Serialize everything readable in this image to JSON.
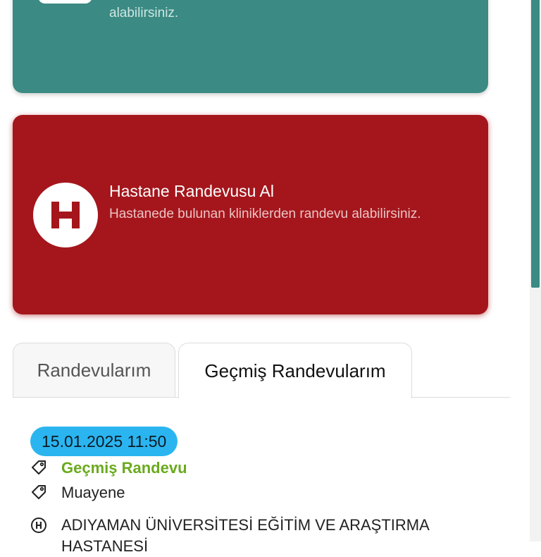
{
  "top_card": {
    "subtitle": "alabilirsiniz.",
    "icon": "stethoscope-icon",
    "color": "#3b8a84"
  },
  "hospital_card": {
    "title": "Hastane Randevusu Al",
    "subtitle": "Hastanede bulunan kliniklerden randevu alabilirsiniz.",
    "icon": "hospital-icon",
    "color": "#a4161c"
  },
  "tabs": [
    {
      "label": "Randevularım",
      "active": false
    },
    {
      "label": "Geçmiş Randevularım",
      "active": true
    }
  ],
  "appointment": {
    "datetime": "15.01.2025 11:50",
    "status": "Geçmiş Randevu",
    "type": "Muayene",
    "hospital": "ADIYAMAN ÜNİVERSİTESİ EĞİTİM VE ARAŞTIRMA",
    "hospital_cont": "HASTANESİ",
    "status_color": "#6aaa1e",
    "badge_color": "#2bb5f0"
  }
}
